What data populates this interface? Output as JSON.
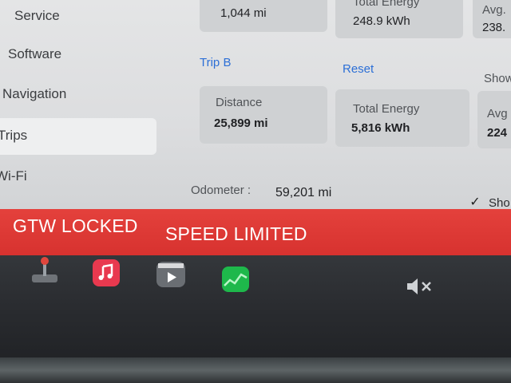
{
  "sidebar": {
    "items": [
      {
        "label": "Service",
        "active": false
      },
      {
        "label": "Software",
        "active": false
      },
      {
        "label": "Navigation",
        "active": false
      },
      {
        "label": "Trips",
        "active": true
      },
      {
        "label": "Wi-Fi",
        "active": false
      }
    ]
  },
  "trip_a": {
    "distance_value": "1,044 mi",
    "energy_label": "Total Energy",
    "energy_value": "248.9 kWh",
    "avg_label": "Avg.",
    "avg_value": "238."
  },
  "trip_b": {
    "title": "Trip B",
    "reset_label": "Reset",
    "show_label": "Show",
    "distance_label": "Distance",
    "distance_value": "25,899 mi",
    "energy_label": "Total Energy",
    "energy_value": "5,816 kWh",
    "avg_label": "Avg",
    "avg_value": "224"
  },
  "odometer": {
    "label": "Odometer :",
    "value": "59,201 mi"
  },
  "show_checkbox": {
    "label": "Sho",
    "checked": true
  },
  "alert": {
    "left_text": "GTW LOCKED",
    "right_text": "SPEED LIMITED",
    "color": "#df3a36"
  },
  "dock": {
    "icons": [
      "joystick-icon",
      "music-icon",
      "video-icon",
      "chart-app-icon",
      "mute-icon"
    ]
  }
}
